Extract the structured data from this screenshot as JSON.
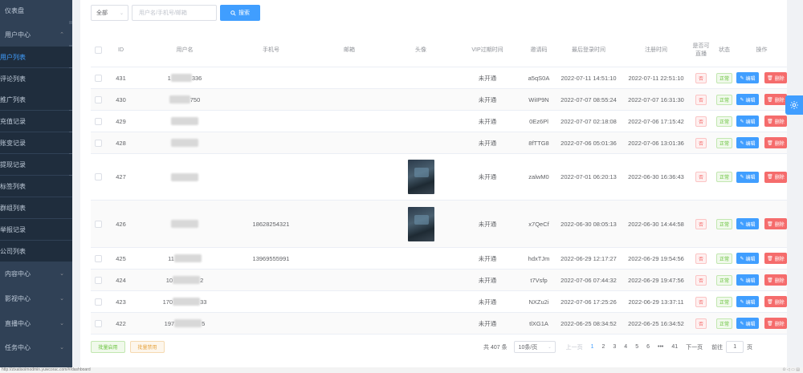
{
  "sidebar": {
    "items": [
      {
        "label": "仪表盘",
        "kind": "top",
        "chevron": ""
      },
      {
        "label": "用户中心",
        "kind": "top",
        "chevron": "⌃"
      },
      {
        "label": "用户列表",
        "kind": "sub",
        "active": true
      },
      {
        "label": "评论列表",
        "kind": "sub"
      },
      {
        "label": "推广列表",
        "kind": "sub"
      },
      {
        "label": "充值记录",
        "kind": "sub"
      },
      {
        "label": "账变记录",
        "kind": "sub"
      },
      {
        "label": "提现记录",
        "kind": "sub"
      },
      {
        "label": "标签列表",
        "kind": "sub"
      },
      {
        "label": "群组列表",
        "kind": "sub"
      },
      {
        "label": "举报记录",
        "kind": "sub"
      },
      {
        "label": "公司列表",
        "kind": "sub"
      },
      {
        "label": "内容中心",
        "kind": "top",
        "chevron": "⌄"
      },
      {
        "label": "影视中心",
        "kind": "top",
        "chevron": "⌄"
      },
      {
        "label": "直播中心",
        "kind": "top",
        "chevron": "⌄"
      },
      {
        "label": "任务中心",
        "kind": "top",
        "chevron": "⌄"
      }
    ]
  },
  "search": {
    "select_value": "全部",
    "input_placeholder": "用户名/手机号/邮箱",
    "button_label": "搜索"
  },
  "table": {
    "headers": [
      "ID",
      "用户名",
      "手机号",
      "邮箱",
      "头像",
      "VIP过期时间",
      "邀请码",
      "最后登录时间",
      "注册时间",
      "是否可直播",
      "状态",
      "操作"
    ],
    "edit_label": "编辑",
    "delete_label": "删除",
    "rows": [
      {
        "id": "431",
        "username_visible": "1",
        "username_tail": "336",
        "phone": "",
        "email": "",
        "avatar": false,
        "vip": "未开通",
        "invite": "a5qS0A",
        "last_login": "2022-07-11 14:51:10",
        "registered": "2022-07-11 22:51:10",
        "live": "否",
        "status": "正常"
      },
      {
        "id": "430",
        "username_visible": "",
        "username_tail": "750",
        "phone": "",
        "email": "",
        "avatar": false,
        "vip": "未开通",
        "invite": "WiIP9N",
        "last_login": "2022-07-07 08:55:24",
        "registered": "2022-07-07 16:31:30",
        "live": "否",
        "status": "正常"
      },
      {
        "id": "429",
        "username_visible": "",
        "username_tail": "",
        "phone": "",
        "email": "",
        "avatar": false,
        "vip": "未开通",
        "invite": "0Ez6Pl",
        "last_login": "2022-07-07 02:18:08",
        "registered": "2022-07-06 17:15:42",
        "live": "否",
        "status": "正常"
      },
      {
        "id": "428",
        "username_visible": "",
        "username_tail": "",
        "phone": "",
        "email": "",
        "avatar": false,
        "vip": "未开通",
        "invite": "8fTTG8",
        "last_login": "2022-07-06 05:01:36",
        "registered": "2022-07-06 13:01:36",
        "live": "否",
        "status": "正常"
      },
      {
        "id": "427",
        "username_visible": "",
        "username_tail": "",
        "phone": "",
        "email": "",
        "avatar": true,
        "vip": "未开通",
        "invite": "zalwM0",
        "last_login": "2022-07-01 06:20:13",
        "registered": "2022-06-30 16:36:43",
        "live": "否",
        "status": "正常"
      },
      {
        "id": "426",
        "username_visible": "",
        "username_tail": "",
        "phone": "18628254321",
        "email": "",
        "avatar": true,
        "vip": "未开通",
        "invite": "x7QeCf",
        "last_login": "2022-06-30 08:05:13",
        "registered": "2022-06-30 14:44:58",
        "live": "否",
        "status": "正常"
      },
      {
        "id": "425",
        "username_visible": "11",
        "username_tail": "",
        "phone": "13969555991",
        "email": "",
        "avatar": false,
        "vip": "未开通",
        "invite": "hdxTJm",
        "last_login": "2022-06-29 12:17:27",
        "registered": "2022-06-29 19:54:56",
        "live": "否",
        "status": "正常"
      },
      {
        "id": "424",
        "username_visible": "10",
        "username_tail": "2",
        "phone": "",
        "email": "",
        "avatar": false,
        "vip": "未开通",
        "invite": "t7Vsfp",
        "last_login": "2022-07-06 07:44:32",
        "registered": "2022-06-29 19:47:56",
        "live": "否",
        "status": "正常"
      },
      {
        "id": "423",
        "username_visible": "170",
        "username_tail": "33",
        "phone": "",
        "email": "",
        "avatar": false,
        "vip": "未开通",
        "invite": "NXZu2i",
        "last_login": "2022-07-06 17:25:26",
        "registered": "2022-06-29 13:37:11",
        "live": "否",
        "status": "正常"
      },
      {
        "id": "422",
        "username_visible": "197",
        "username_tail": "5",
        "phone": "",
        "email": "",
        "avatar": false,
        "vip": "未开通",
        "invite": "tlXG1A",
        "last_login": "2022-06-25 08:34:52",
        "registered": "2022-06-25 16:34:52",
        "live": "否",
        "status": "正常"
      }
    ]
  },
  "footer": {
    "bulk_enable": "批量启用",
    "bulk_disable": "批量禁用",
    "total": "共 407 条",
    "page_size": "10条/页",
    "prev": "上一页",
    "pages": [
      "1",
      "2",
      "3",
      "4",
      "5",
      "6",
      "•••",
      "41"
    ],
    "current_page": "1",
    "next": "下一页",
    "goto_prefix": "前往",
    "goto_value": "1",
    "goto_suffix": "页"
  },
  "statusbar": {
    "url": "http://zixatisoimodmin.yuwcorac.com/#/dashboard"
  },
  "colors": {
    "primary": "#409eff",
    "danger": "#f56c6c",
    "success": "#67c23a",
    "sidebar_bg": "#304156"
  }
}
